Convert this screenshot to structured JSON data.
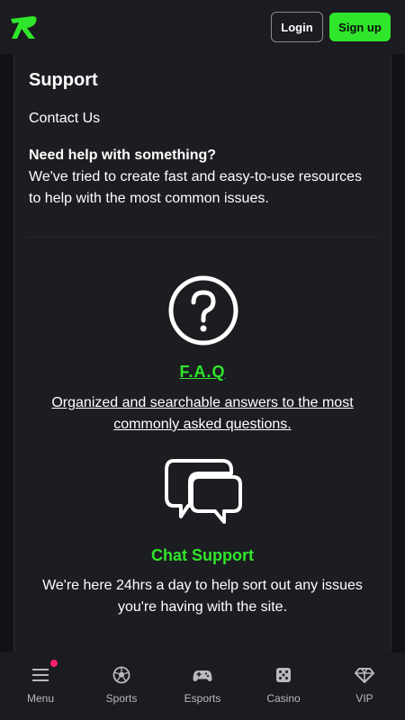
{
  "header": {
    "login_label": "Login",
    "signup_label": "Sign up"
  },
  "support": {
    "title": "Support",
    "contact_label": "Contact Us",
    "help_heading": "Need help with something?",
    "help_body": "We've tried to create fast and easy-to-use resources to help with the most common issues."
  },
  "faq": {
    "icon": "question-circle-icon",
    "title": "F.A.Q",
    "description": "Organized and searchable answers to the most commonly asked questions."
  },
  "chat": {
    "icon": "chat-bubbles-icon",
    "title": "Chat Support",
    "description": "We're here 24hrs a day to help sort out any issues you're having with the site."
  },
  "bottom_nav": {
    "items": [
      {
        "label": "Menu",
        "icon": "menu-icon"
      },
      {
        "label": "Sports",
        "icon": "soccer-ball-icon"
      },
      {
        "label": "Esports",
        "icon": "gamepad-icon"
      },
      {
        "label": "Casino",
        "icon": "dice-icon"
      },
      {
        "label": "VIP",
        "icon": "diamond-icon"
      }
    ]
  },
  "colors": {
    "accent": "#2fe62b",
    "background": "#111215",
    "panel": "#1c1d21",
    "notification": "#ff1f6b"
  }
}
